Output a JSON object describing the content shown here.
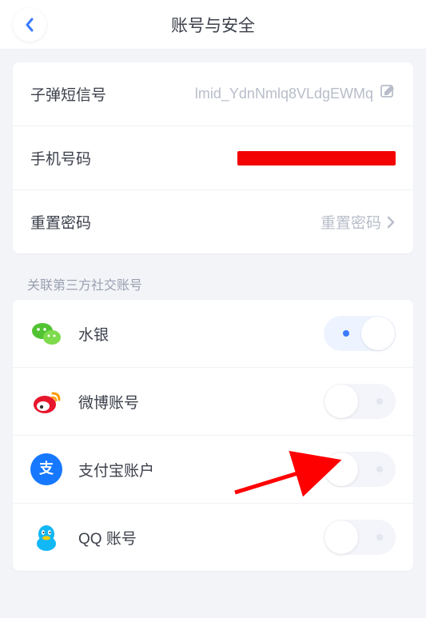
{
  "header": {
    "title": "账号与安全"
  },
  "account": {
    "id_label": "子弹短信号",
    "id_value": "lmid_YdnNmlq8VLdgEWMq",
    "phone_label": "手机号码",
    "reset_label": "重置密码",
    "reset_action": "重置密码"
  },
  "linked": {
    "section_title": "关联第三方社交账号",
    "items": [
      {
        "icon": "wechat",
        "label": "水银",
        "on": true
      },
      {
        "icon": "weibo",
        "label": "微博账号",
        "on": false
      },
      {
        "icon": "alipay",
        "label": "支付宝账户",
        "on": false
      },
      {
        "icon": "qq",
        "label": "QQ 账号",
        "on": false
      }
    ]
  }
}
